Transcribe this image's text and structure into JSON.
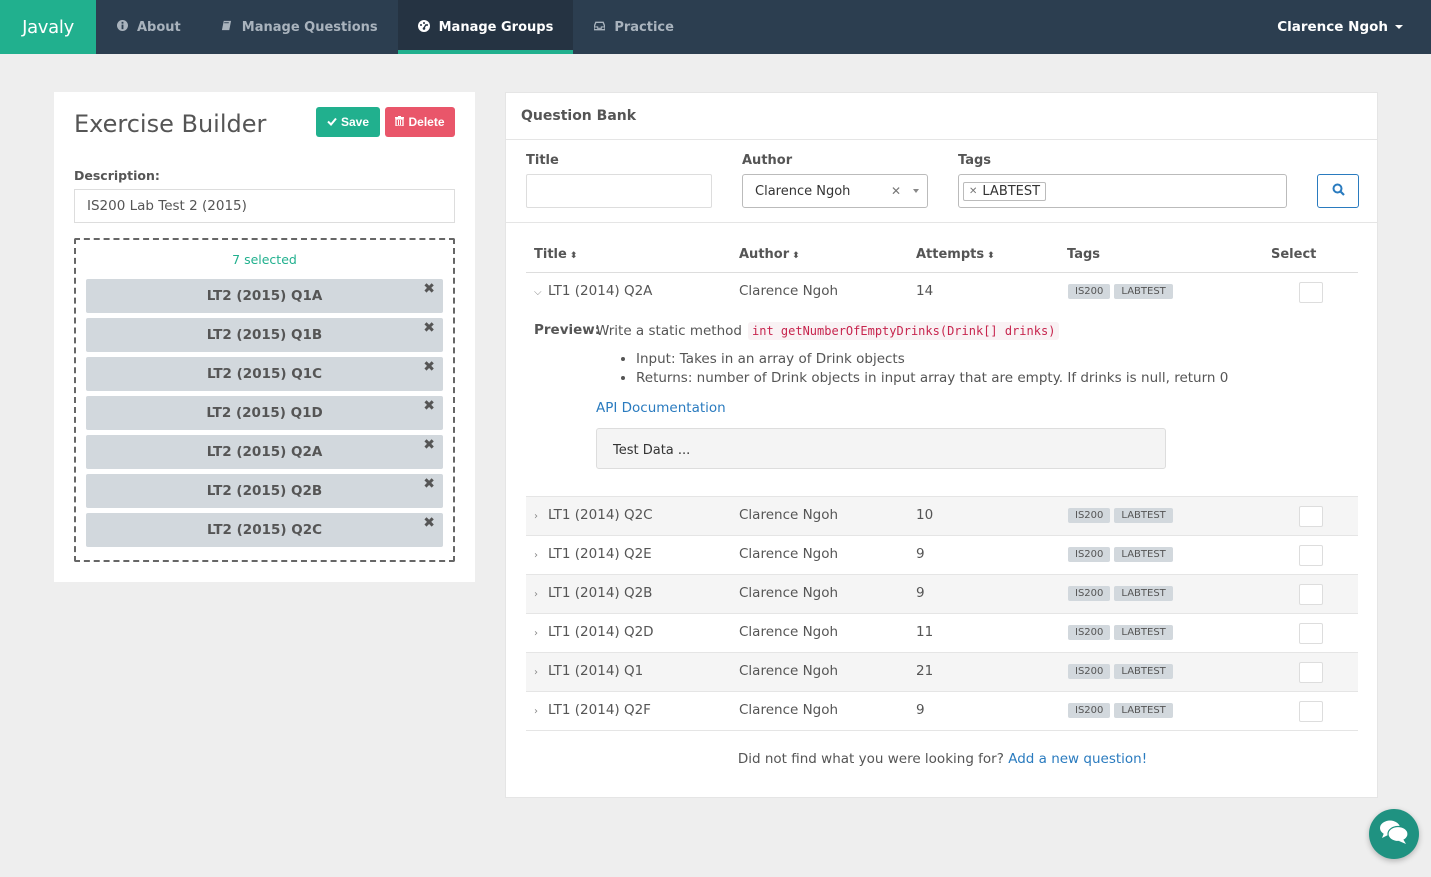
{
  "navbar": {
    "brand": "Javaly",
    "items": [
      {
        "label": "About",
        "icon": "info-circle-icon",
        "active": false
      },
      {
        "label": "Manage Questions",
        "icon": "book-icon",
        "active": false
      },
      {
        "label": "Manage Groups",
        "icon": "dashboard-icon",
        "active": true
      },
      {
        "label": "Practice",
        "icon": "inbox-icon",
        "active": false
      }
    ],
    "user": "Clarence Ngoh"
  },
  "exercise_builder": {
    "title": "Exercise Builder",
    "save_label": "Save",
    "delete_label": "Delete",
    "description_label": "Description:",
    "description_value": "IS200 Lab Test 2 (2015)",
    "selected_count": "7 selected",
    "selected_items": [
      "LT2 (2015) Q1A",
      "LT2 (2015) Q1B",
      "LT2 (2015) Q1C",
      "LT2 (2015) Q1D",
      "LT2 (2015) Q2A",
      "LT2 (2015) Q2B",
      "LT2 (2015) Q2C"
    ]
  },
  "question_bank": {
    "title": "Question Bank",
    "filters": {
      "title_label": "Title",
      "title_value": "",
      "author_label": "Author",
      "author_value": "Clarence Ngoh",
      "tags_label": "Tags",
      "tags_value": [
        "LABTEST"
      ]
    },
    "columns": [
      "Title",
      "Author",
      "Attempts",
      "Tags",
      "Select"
    ],
    "rows": [
      {
        "title": "LT1 (2014) Q2A",
        "author": "Clarence Ngoh",
        "attempts": "14",
        "tags": [
          "IS200",
          "LABTEST"
        ],
        "expanded": true
      },
      {
        "title": "LT1 (2014) Q2C",
        "author": "Clarence Ngoh",
        "attempts": "10",
        "tags": [
          "IS200",
          "LABTEST"
        ],
        "expanded": false
      },
      {
        "title": "LT1 (2014) Q2E",
        "author": "Clarence Ngoh",
        "attempts": "9",
        "tags": [
          "IS200",
          "LABTEST"
        ],
        "expanded": false
      },
      {
        "title": "LT1 (2014) Q2B",
        "author": "Clarence Ngoh",
        "attempts": "9",
        "tags": [
          "IS200",
          "LABTEST"
        ],
        "expanded": false
      },
      {
        "title": "LT1 (2014) Q2D",
        "author": "Clarence Ngoh",
        "attempts": "11",
        "tags": [
          "IS200",
          "LABTEST"
        ],
        "expanded": false
      },
      {
        "title": "LT1 (2014) Q1",
        "author": "Clarence Ngoh",
        "attempts": "21",
        "tags": [
          "IS200",
          "LABTEST"
        ],
        "expanded": false
      },
      {
        "title": "LT1 (2014) Q2F",
        "author": "Clarence Ngoh",
        "attempts": "9",
        "tags": [
          "IS200",
          "LABTEST"
        ],
        "expanded": false
      }
    ],
    "preview": {
      "label": "Preview:",
      "intro": "Write a static method",
      "code": "int getNumberOfEmptyDrinks(Drink[] drinks)",
      "bullets": [
        "Input: Takes in an array of Drink objects",
        "Returns: number of Drink objects in input array that are empty. If drinks is null, return 0"
      ],
      "api_link": "API Documentation",
      "test_data": "Test Data ..."
    },
    "footer_text": "Did not find what you were looking for?",
    "footer_link": "Add a new question!"
  },
  "colors": {
    "brand": "#21b08e",
    "navbar": "#2c3e50",
    "danger": "#e9566a",
    "link": "#2a7bbf",
    "chat": "#1f9281"
  }
}
